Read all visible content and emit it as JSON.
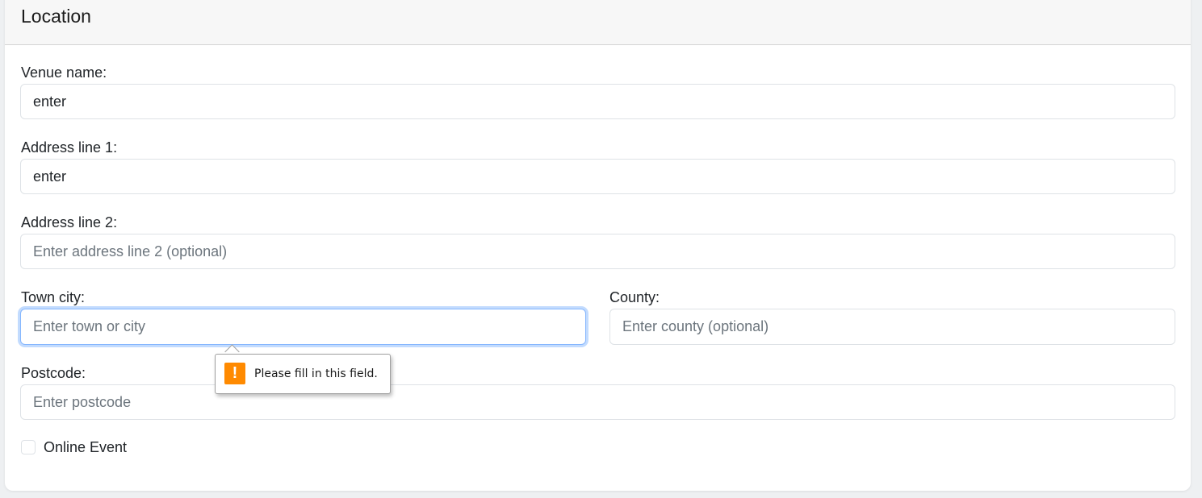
{
  "header": {
    "title": "Location"
  },
  "fields": {
    "venue": {
      "label": "Venue name:",
      "value": "enter",
      "placeholder": ""
    },
    "address1": {
      "label": "Address line 1:",
      "value": "enter",
      "placeholder": ""
    },
    "address2": {
      "label": "Address line 2:",
      "value": "",
      "placeholder": "Enter address line 2 (optional)"
    },
    "town": {
      "label": "Town city:",
      "value": "",
      "placeholder": "Enter town or city"
    },
    "county": {
      "label": "County:",
      "value": "",
      "placeholder": "Enter county (optional)"
    },
    "postcode": {
      "label": "Postcode:",
      "value": "",
      "placeholder": "Enter postcode"
    }
  },
  "online_event": {
    "label": "Online Event",
    "checked": false
  },
  "validation_tooltip": {
    "icon": "warning-exclamation-icon",
    "icon_glyph": "!",
    "message": "Please fill in this field.",
    "color": "#ff8a00"
  }
}
